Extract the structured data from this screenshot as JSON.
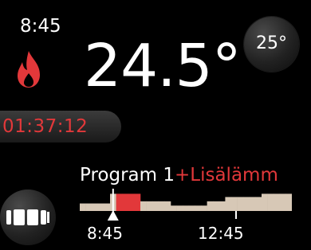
{
  "status": {
    "clock": "8:45",
    "current_temperature": "24.5°",
    "timer": "01:37:12",
    "heating_icon": "flame-icon"
  },
  "setpoint": {
    "label": "25°"
  },
  "program": {
    "name": "Program 1",
    "extra": "+Lisälämm"
  },
  "mode": {
    "icon": "mode-blocks-icon"
  },
  "schedule": {
    "time_labels": [
      "8:45",
      "12:45"
    ],
    "levels": [
      0.35,
      0.35,
      0.35,
      0.35,
      0.35,
      0.8,
      0.8,
      0.8,
      0.8,
      0.8,
      0.45,
      0.45,
      0.45,
      0.45,
      0.45,
      0.25,
      0.25,
      0.25,
      0.25,
      0.25,
      0.25,
      0.45,
      0.45,
      0.45,
      0.65,
      0.65,
      0.65,
      0.65,
      0.65,
      0.65,
      0.8,
      0.8,
      0.8,
      0.8,
      0.8
    ],
    "active_segments": [
      6,
      7,
      8,
      9
    ],
    "current_index": 5
  },
  "colors": {
    "accent_red": "#e2383a",
    "bar_beige": "#d7c8b6",
    "background": "#000000",
    "text": "#ffffff"
  }
}
